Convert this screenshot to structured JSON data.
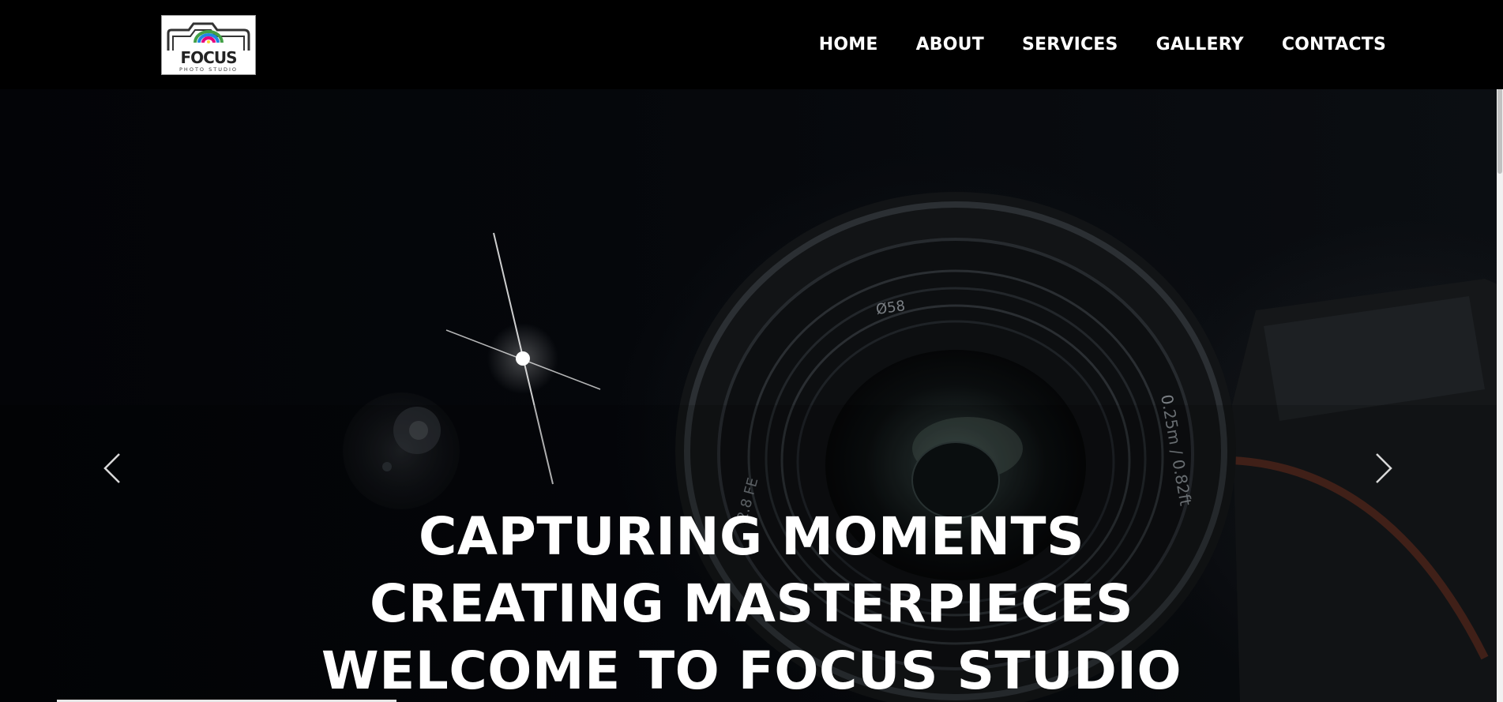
{
  "header": {
    "logo": {
      "wordmark": "FOCUS",
      "tagline": "PHOTO STUDIO",
      "icon": "camera-logo-icon"
    },
    "nav": [
      {
        "label": "HOME"
      },
      {
        "label": "ABOUT"
      },
      {
        "label": "SERVICES"
      },
      {
        "label": "GALLERY"
      },
      {
        "label": "CONTACTS"
      }
    ]
  },
  "hero": {
    "lines": [
      "CAPTURING MOMENTS",
      "CREATING MASTERPIECES",
      "WELCOME TO FOCUS STUDIO"
    ],
    "prev_icon": "chevron-left-icon",
    "next_icon": "chevron-right-icon",
    "lens_markings": {
      "filter": "Ø58",
      "distance": "0.25m / 0.82ft",
      "aperture": "2.8 FE"
    }
  },
  "colors": {
    "background": "#000000",
    "text": "#ffffff",
    "logo_pink": "#e5007e",
    "logo_blue": "#1e88e5",
    "logo_green": "#43a047",
    "logo_yellow": "#fdd835"
  }
}
